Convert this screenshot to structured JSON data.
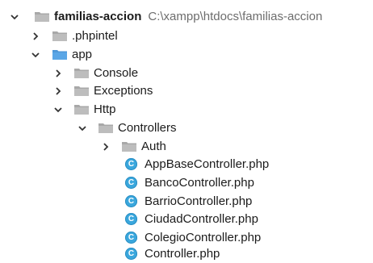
{
  "project": {
    "name": "familias-accion",
    "path": "C:\\xampp\\htdocs\\familias-accion"
  },
  "tree": {
    "phpintel": ".phpintel",
    "app": "app",
    "console": "Console",
    "exceptions": "Exceptions",
    "http": "Http",
    "controllers": "Controllers",
    "auth": "Auth",
    "files": [
      "AppBaseController.php",
      "BancoController.php",
      "BarrioController.php",
      "CiudadController.php",
      "ColegioController.php",
      "Controller.php"
    ]
  },
  "icons": {
    "folder": "folder-icon",
    "folder_blue": "folder-blue-icon",
    "class_file": "php-class-icon",
    "chevron_right": "chevron-right-icon",
    "chevron_down": "chevron-down-icon"
  },
  "colors": {
    "folder_gray": "#a8a8a8",
    "folder_blue": "#5aa6e6",
    "class_blue": "#3aa7dd",
    "path_gray": "#6d6d6d"
  }
}
